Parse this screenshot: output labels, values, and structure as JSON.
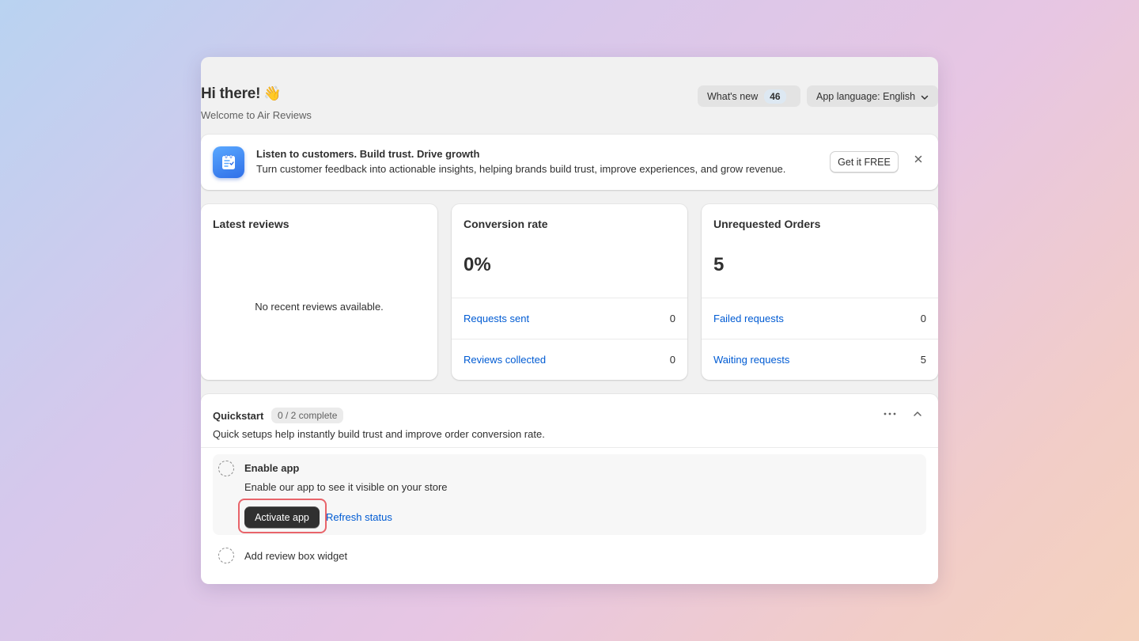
{
  "header": {
    "greeting": "Hi there!",
    "wave_emoji": "👋",
    "subtitle": "Welcome to Air Reviews",
    "whats_new_label": "What's new",
    "whats_new_count": "46",
    "language_label": "App language: English"
  },
  "banner": {
    "icon": "clipboard-checklist-icon",
    "title": "Listen to customers. Build trust. Drive growth",
    "text": "Turn customer feedback into actionable insights, helping brands build trust, improve experiences, and grow revenue.",
    "cta_label": "Get it FREE"
  },
  "latest_reviews": {
    "title": "Latest reviews",
    "empty_message": "No recent reviews available."
  },
  "conversion": {
    "title": "Conversion rate",
    "value": "0%",
    "rows": [
      {
        "label": "Requests sent",
        "value": "0"
      },
      {
        "label": "Reviews collected",
        "value": "0"
      }
    ]
  },
  "unrequested": {
    "title": "Unrequested Orders",
    "value": "5",
    "rows": [
      {
        "label": "Failed requests",
        "value": "0"
      },
      {
        "label": "Waiting requests",
        "value": "5"
      }
    ]
  },
  "quickstart": {
    "title": "Quickstart",
    "progress": "0 / 2 complete",
    "subtitle": "Quick setups help instantly build trust and improve order conversion rate.",
    "tasks": [
      {
        "title": "Enable app",
        "description": "Enable our app to see it visible on your store",
        "primary_label": "Activate app",
        "secondary_label": "Refresh status"
      },
      {
        "title": "Add review box widget"
      }
    ]
  },
  "colors": {
    "link": "#005bd3",
    "primary_button": "#303030",
    "highlight": "#e8646a",
    "banner_icon": "#2f6fe8"
  }
}
